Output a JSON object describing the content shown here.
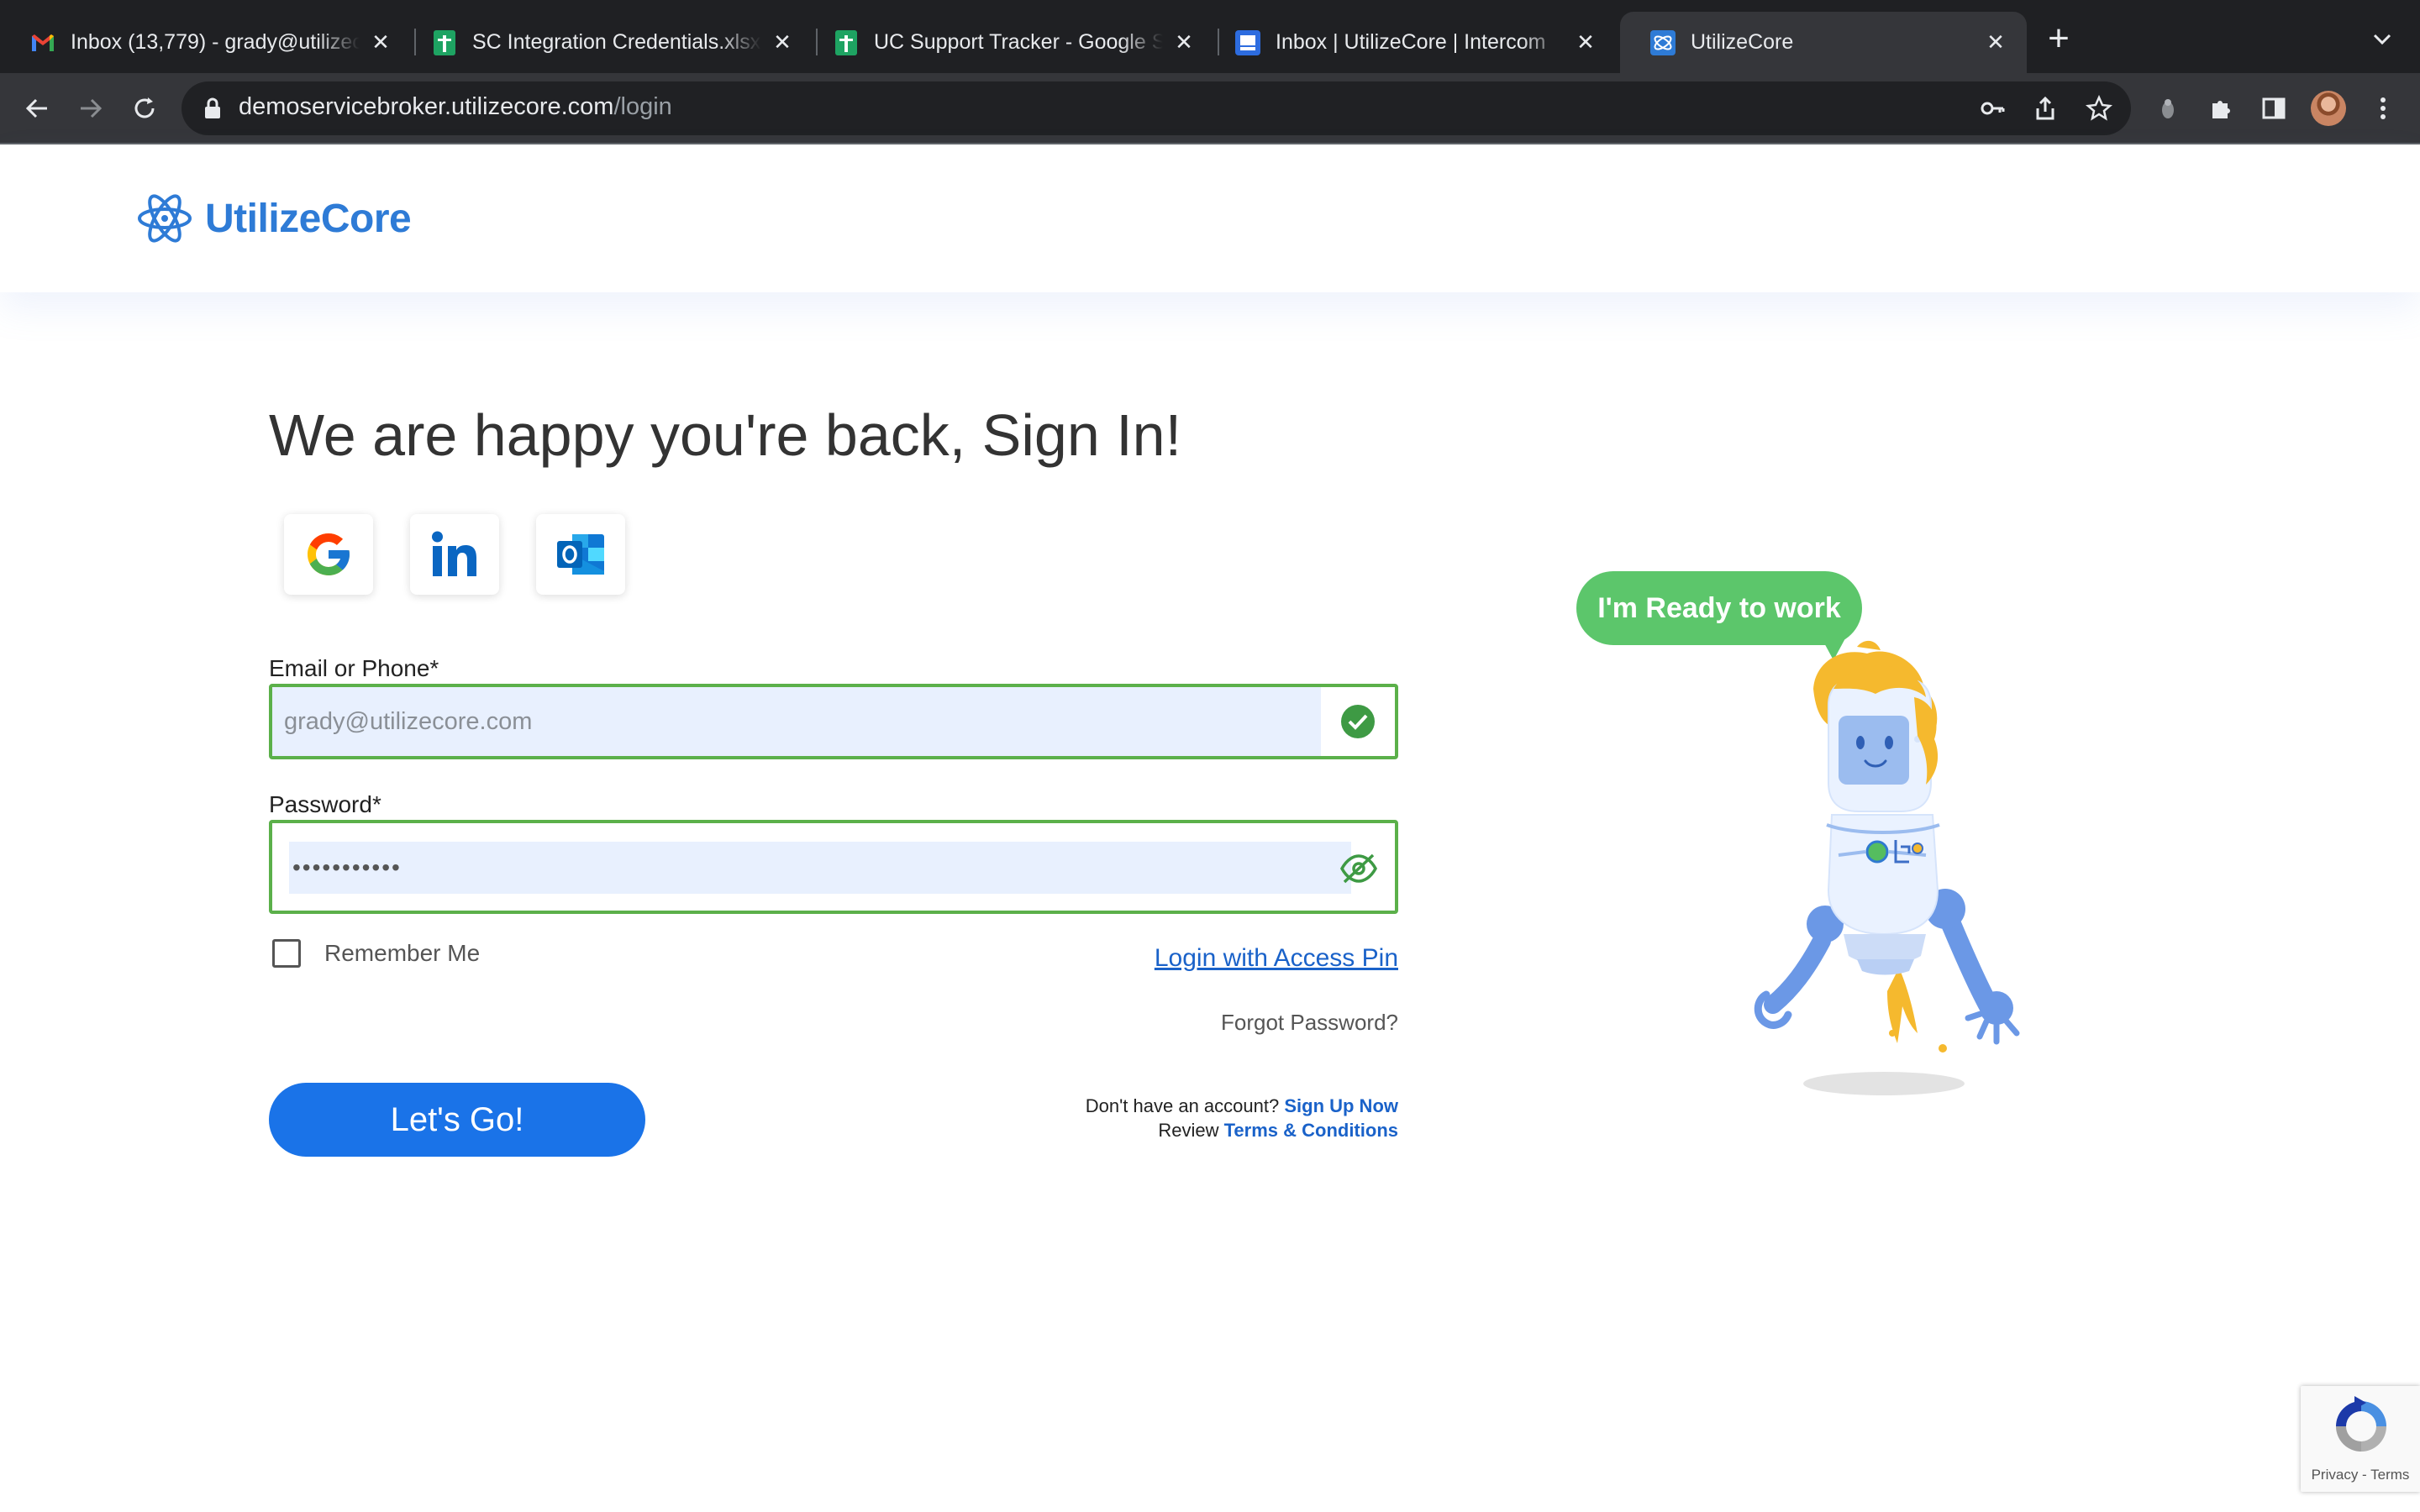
{
  "browser": {
    "tabs": [
      {
        "title": "Inbox (13,779) - grady@utilizecore.com",
        "icon": "gmail-icon",
        "active": false
      },
      {
        "title": "SC Integration Credentials.xlsx",
        "icon": "sheets-icon",
        "active": false
      },
      {
        "title": "UC Support Tracker - Google Sheets",
        "icon": "sheets-icon",
        "active": false
      },
      {
        "title": "Inbox | UtilizeCore | Intercom",
        "icon": "intercom-icon",
        "active": false
      },
      {
        "title": "UtilizeCore",
        "icon": "utilizecore-icon",
        "active": true
      }
    ],
    "url_host": "demoservicebroker.utilizecore.com",
    "url_path": "/login"
  },
  "header": {
    "logo_text": "UtilizeCore"
  },
  "login": {
    "heading": "We are happy you're back, Sign In!",
    "social_providers": [
      "google-icon",
      "linkedin-icon",
      "outlook-icon"
    ],
    "email_label": "Email or Phone*",
    "email_value": "grady@utilizecore.com",
    "password_label": "Password*",
    "password_value": "•••••••••••",
    "remember_label": "Remember Me",
    "access_pin_link": "Login with Access Pin",
    "forgot_link": "Forgot Password?",
    "submit_label": "Let's Go!",
    "signup_prompt": "Don't have an account?",
    "signup_link": "Sign Up Now",
    "terms_prompt": "Review",
    "terms_link": "Terms & Conditions"
  },
  "illustration": {
    "bubble_text": "I'm Ready to work"
  },
  "recaptcha": {
    "text": "Privacy - Terms"
  },
  "colors": {
    "brand_blue": "#2e7bd6",
    "button_blue": "#1a73e8",
    "valid_green": "#5bb04a",
    "bubble_green": "#5cc66b",
    "autofill_blue": "#e8f0fe"
  }
}
